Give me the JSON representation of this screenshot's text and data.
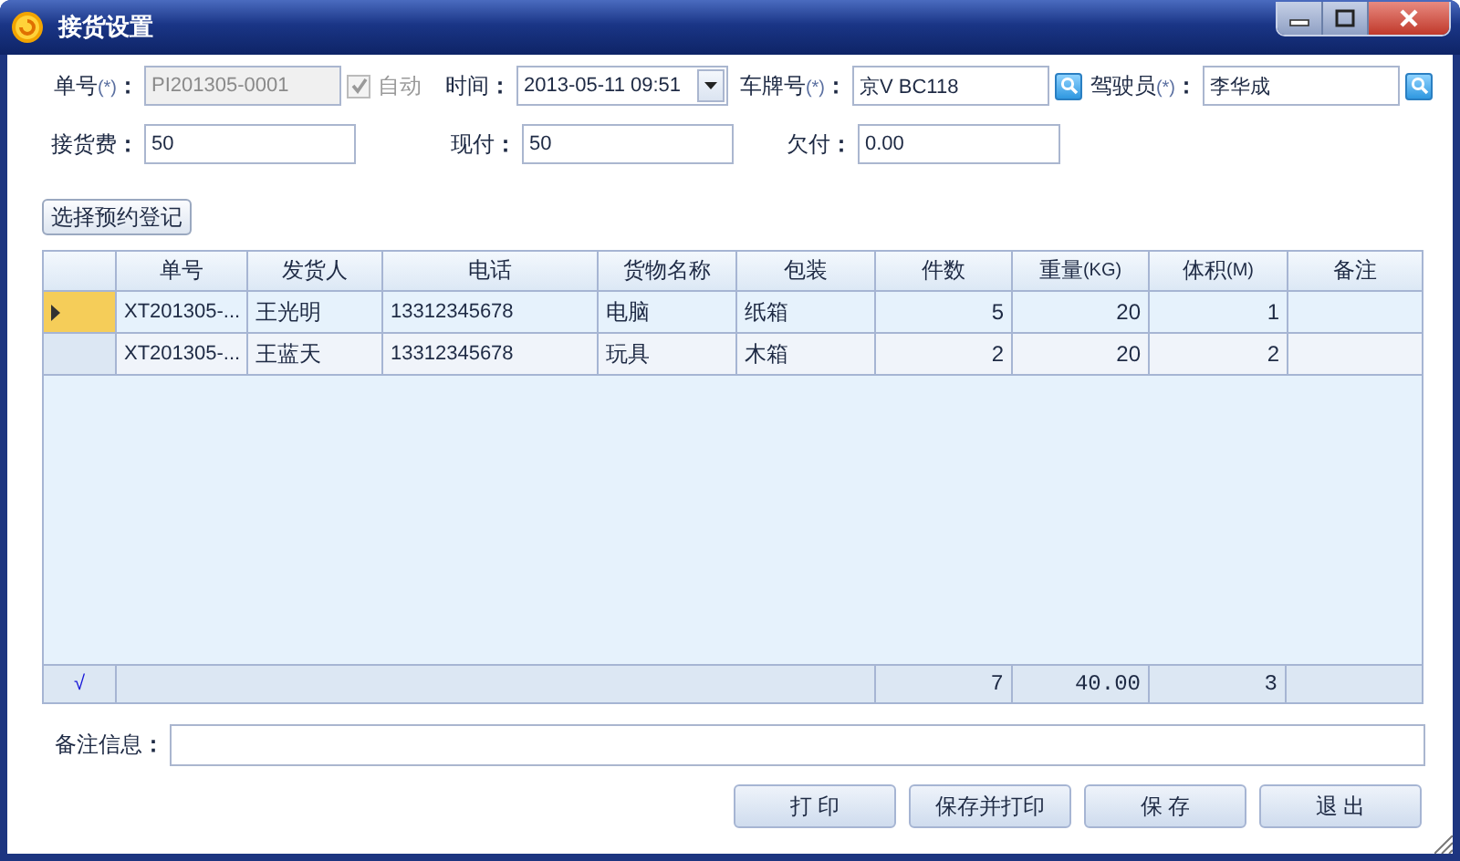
{
  "window": {
    "title": "接货设置"
  },
  "form_rows": [
    [
      {
        "kind": "text",
        "label": "单号",
        "mark": "(*)",
        "colon": "：",
        "value": "PI201305-0001",
        "disabled": true
      },
      {
        "kind": "checkbox",
        "label": "自动",
        "checked": true,
        "disabled": true
      },
      {
        "kind": "datetime",
        "label": "时间",
        "colon": "：",
        "value": "2013-05-11 09:51"
      },
      {
        "kind": "lookup",
        "label": "车牌号",
        "mark": "(*)",
        "colon": "：",
        "value": "京V BC118"
      },
      {
        "kind": "lookup",
        "label": "驾驶员",
        "mark": "(*)",
        "colon": "：",
        "value": "李华成"
      }
    ],
    [
      {
        "kind": "text",
        "label": "接货费",
        "colon": "：",
        "value": "50"
      },
      {
        "kind": "text",
        "label": "现付",
        "colon": "：",
        "value": "50"
      },
      {
        "kind": "text",
        "label": "欠付",
        "colon": "：",
        "value": "0.00"
      }
    ]
  ],
  "select_button": "选择预约登记",
  "table": {
    "columns": [
      {
        "label": "单号",
        "kind": "text"
      },
      {
        "label": "发货人",
        "kind": "text"
      },
      {
        "label": "电话",
        "kind": "text"
      },
      {
        "label": "货物名称",
        "kind": "text"
      },
      {
        "label": "包装",
        "kind": "text"
      },
      {
        "label": "件数",
        "kind": "number"
      },
      {
        "label": "重量",
        "unit": "(KG)",
        "kind": "number"
      },
      {
        "label": "体积",
        "unit": "(M)",
        "kind": "number"
      },
      {
        "label": "备注",
        "kind": "text"
      }
    ],
    "rows": [
      {
        "selected": true,
        "cells": [
          "XT201305-...",
          "王光明",
          "13312345678",
          "电脑",
          "纸箱",
          "5",
          "20",
          "1"
        ]
      },
      {
        "selected": false,
        "cells": [
          "XT201305-...",
          "王蓝天",
          "13312345678",
          "玩具",
          "木箱",
          "2",
          "20",
          "2"
        ]
      }
    ],
    "totals": {
      "mark": "√",
      "pieces": "7",
      "weight": "40.00",
      "volume": "3"
    }
  },
  "remarks": {
    "label": "备注信息",
    "colon": "："
  },
  "buttons": [
    "打 印",
    "保存并打印",
    "保 存",
    "退 出"
  ]
}
